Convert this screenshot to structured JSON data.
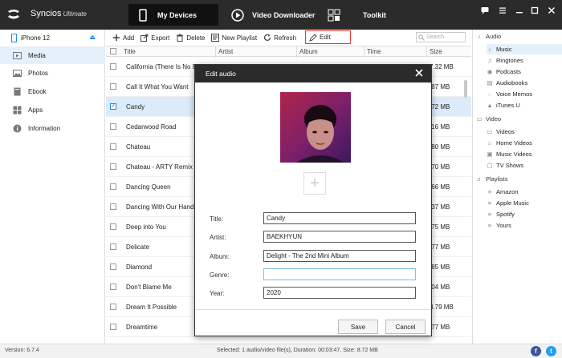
{
  "app": {
    "name": "Syncios",
    "edition": "Ultimate"
  },
  "nav": {
    "tabs": [
      {
        "label": "My Devices",
        "icon": "phone-icon",
        "active": true
      },
      {
        "label": "Video Downloader",
        "icon": "play-circle-icon",
        "active": false
      },
      {
        "label": "Toolkit",
        "icon": "grid-icon",
        "active": false
      }
    ]
  },
  "window_controls": [
    "chat-icon",
    "menu-icon",
    "minimize-icon",
    "maximize-icon",
    "close-icon"
  ],
  "device": {
    "name": "iPhone 12"
  },
  "sidebar": {
    "items": [
      {
        "label": "Media",
        "icon": "media-icon",
        "active": true
      },
      {
        "label": "Photos",
        "icon": "photo-icon",
        "active": false
      },
      {
        "label": "Ebook",
        "icon": "book-icon",
        "active": false
      },
      {
        "label": "Apps",
        "icon": "apps-icon",
        "active": false
      },
      {
        "label": "Information",
        "icon": "info-icon",
        "active": false
      }
    ]
  },
  "toolbar": {
    "add": "Add",
    "export": "Export",
    "delete": "Delete",
    "new_playlist": "New Playlist",
    "refresh": "Refresh",
    "edit": "Edit",
    "search_placeholder": "Search"
  },
  "table": {
    "columns": [
      "Title",
      "Artist",
      "Album",
      "Time",
      "Size"
    ],
    "rows": [
      {
        "title": "California (There Is No End to Love)",
        "size": "7.32 MB",
        "checked": false
      },
      {
        "title": "Call It What You Want",
        "size": ".87 MB",
        "checked": false
      },
      {
        "title": "Candy",
        "size": ".72 MB",
        "checked": true
      },
      {
        "title": "Cedarwood Road",
        "size": ".16 MB",
        "checked": false
      },
      {
        "title": "Chateau",
        "size": ".80 MB",
        "checked": false
      },
      {
        "title": "Chateau - ARTY Remix",
        "size": ".70 MB",
        "checked": false
      },
      {
        "title": "Dancing Queen",
        "size": ".66 MB",
        "checked": false
      },
      {
        "title": "Dancing With Our Hands Tied",
        "size": ".37 MB",
        "checked": false
      },
      {
        "title": "Deep into You",
        "size": ".75 MB",
        "checked": false
      },
      {
        "title": "Delicate",
        "size": ".77 MB",
        "checked": false
      },
      {
        "title": "Diamond",
        "size": ".85 MB",
        "checked": false
      },
      {
        "title": "Don't Blame Me",
        "size": ".04 MB",
        "checked": false
      },
      {
        "title": "Dream It Possible",
        "size": "3.79 MB",
        "checked": false
      },
      {
        "title": "Dreamtime",
        "size": ".77 MB",
        "checked": false
      }
    ]
  },
  "right_sidebar": {
    "audio": {
      "header": "Audio",
      "items": [
        "Music",
        "Ringtones",
        "Podcasts",
        "Audiobooks",
        "Voice Memos",
        "iTunes U"
      ]
    },
    "video": {
      "header": "Video",
      "items": [
        "Videos",
        "Home Videos",
        "Music Videos",
        "TV Shows"
      ]
    },
    "playlists": {
      "header": "Playlists",
      "items": [
        "Amazon",
        "Apple Music",
        "Spotify",
        "Yours"
      ]
    }
  },
  "status": {
    "version": "Version: 6.7.4",
    "info": "Selected: 1 audio/video file(s), Duration: 00:03:47, Size: 8.72 MB"
  },
  "social": [
    "f",
    "t"
  ],
  "dialog": {
    "title": "Edit audio",
    "fields": [
      {
        "label": "Title:",
        "value": "Candy"
      },
      {
        "label": "Artist:",
        "value": "BAEKHYUN"
      },
      {
        "label": "Album:",
        "value": "Delight - The 2nd Mini Album"
      },
      {
        "label": "Genre:",
        "value": ""
      },
      {
        "label": "Year:",
        "value": "2020"
      }
    ],
    "save": "Save",
    "cancel": "Cancel"
  },
  "colors": {
    "titlebar": "#2b2b2b",
    "accent": "#1e88e5",
    "selection": "#dcebf9",
    "highlight_box": "#e53935",
    "facebook": "#3b5998",
    "twitter": "#1da1f2"
  }
}
